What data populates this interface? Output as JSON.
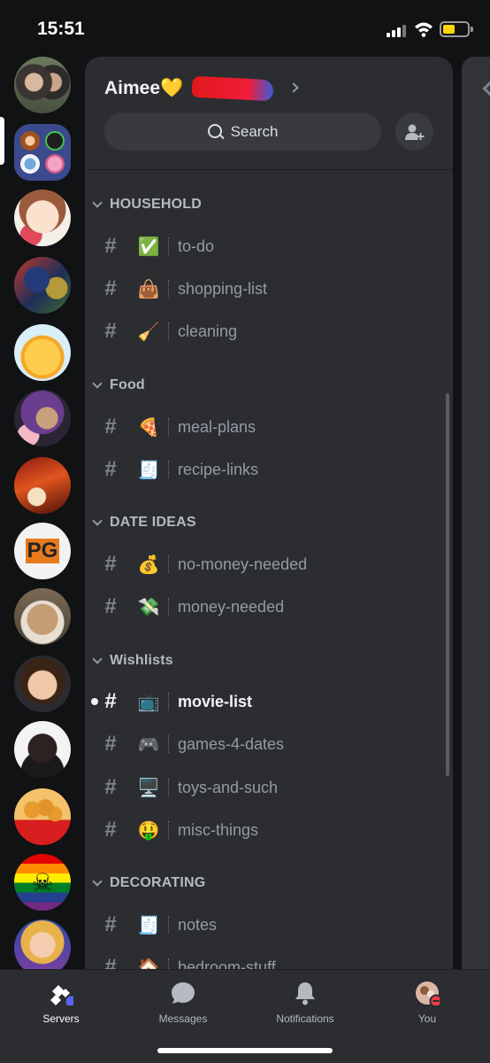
{
  "status": {
    "time": "15:51"
  },
  "server_header": {
    "name": "Aimee💛",
    "search_label": "Search"
  },
  "categories": [
    {
      "label": "HOUSEHOLD",
      "channels": [
        {
          "emoji": "✅",
          "name": "to-do"
        },
        {
          "emoji": "👜",
          "name": "shopping-list"
        },
        {
          "emoji": "🧹",
          "name": "cleaning"
        }
      ]
    },
    {
      "label": "Food",
      "channels": [
        {
          "emoji": "🍕",
          "name": "meal-plans"
        },
        {
          "emoji": "🧾",
          "name": "recipe-links"
        }
      ]
    },
    {
      "label": "DATE IDEAS",
      "channels": [
        {
          "emoji": "💰",
          "name": "no-money-needed"
        },
        {
          "emoji": "💸",
          "name": "money-needed"
        }
      ]
    },
    {
      "label": "Wishlists",
      "channels": [
        {
          "emoji": "📺",
          "name": "movie-list",
          "active": true
        },
        {
          "emoji": "🎮",
          "name": "games-4-dates"
        },
        {
          "emoji": "🖥️",
          "name": "toys-and-such"
        },
        {
          "emoji": "🤑",
          "name": "misc-things"
        }
      ]
    },
    {
      "label": "DECORATING",
      "channels": [
        {
          "emoji": "🧾",
          "name": "notes"
        },
        {
          "emoji": "🏠",
          "name": "bedroom-stuff"
        }
      ]
    }
  ],
  "tabs": [
    {
      "label": "Servers",
      "icon": "servers-icon",
      "active": true
    },
    {
      "label": "Messages",
      "icon": "messages-icon"
    },
    {
      "label": "Notifications",
      "icon": "bell-icon"
    },
    {
      "label": "You",
      "icon": "avatar-icon"
    }
  ],
  "colors": {
    "background": "#111214",
    "panel": "#2b2d31",
    "accent": "#5865f2",
    "muted_text": "#949ba4",
    "dnd_red": "#f23f43"
  },
  "servers": [
    {
      "icon": "server-photo-couple"
    },
    {
      "icon": "server-folder"
    },
    {
      "icon": "server-anime-avatar"
    },
    {
      "icon": "server-art-painting"
    },
    {
      "icon": "server-bee-emoji"
    },
    {
      "icon": "server-purple-character"
    },
    {
      "icon": "server-red-art"
    },
    {
      "icon": "server-pg-logo"
    },
    {
      "icon": "server-dog-photo"
    },
    {
      "icon": "server-bitmoji"
    },
    {
      "icon": "server-portrait"
    },
    {
      "icon": "server-nuggets"
    },
    {
      "icon": "server-pride-pirate"
    },
    {
      "icon": "server-comic-hero"
    }
  ]
}
